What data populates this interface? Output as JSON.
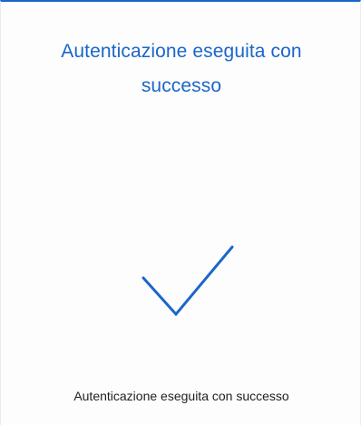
{
  "panel": {
    "title": "Autenticazione eseguita con successo",
    "status_icon": "checkmark-icon",
    "message": "Autenticazione eseguita con successo"
  },
  "colors": {
    "accent": "#1b66c9",
    "text": "#1f1f1f",
    "background": "#fdfdfd"
  }
}
